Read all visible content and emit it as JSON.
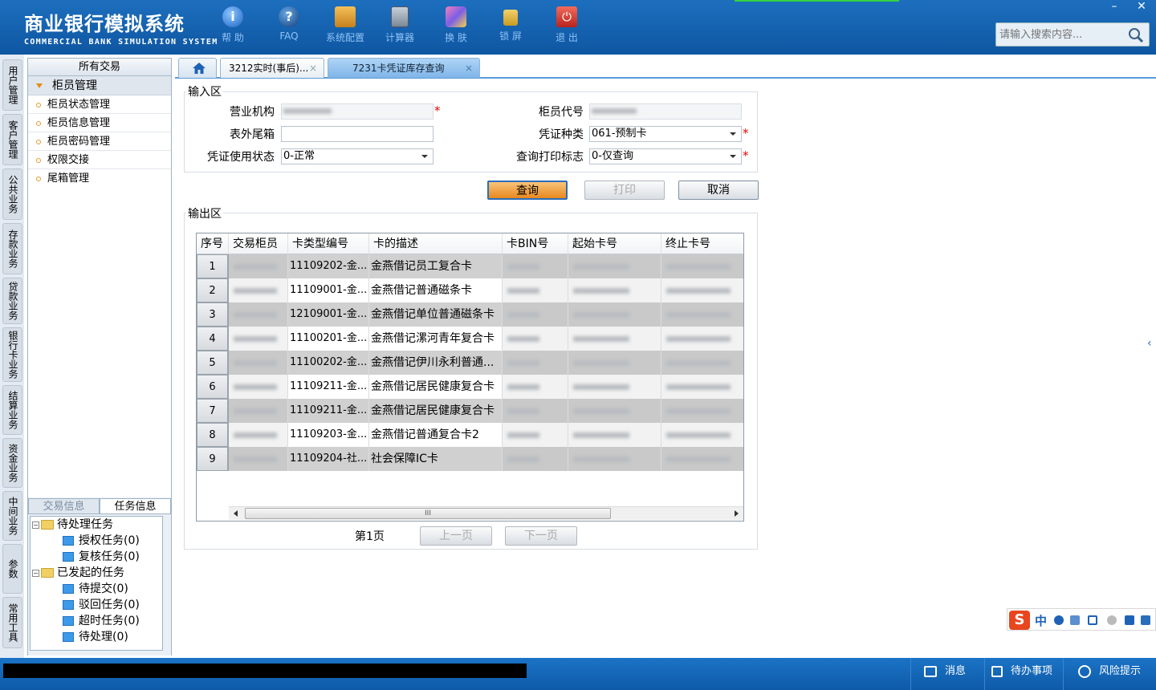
{
  "app": {
    "title_cn": "商业银行模拟系统",
    "title_en": "COMMERCIAL BANK SIMULATION SYSTEM",
    "window_buttons": [
      "–",
      "✕"
    ]
  },
  "toolbar": [
    {
      "label": "帮 助",
      "icon": "info-icon"
    },
    {
      "label": "FAQ",
      "icon": "question-icon"
    },
    {
      "label": "系统配置",
      "icon": "toolbox-icon"
    },
    {
      "label": "计算器",
      "icon": "calculator-icon"
    },
    {
      "label": "换 肤",
      "icon": "shirt-icon"
    },
    {
      "label": "锁 屏",
      "icon": "lock-icon"
    },
    {
      "label": "退 出",
      "icon": "power-icon"
    }
  ],
  "search": {
    "placeholder": "请输入搜索内容..."
  },
  "left_tabs": [
    "用户管理",
    "客户管理",
    "公共业务",
    "存款业务",
    "贷款业务",
    "银行卡业务",
    "结算业务",
    "资金业务",
    "中间业务",
    "参数",
    "常用工具"
  ],
  "sidebar": {
    "header": "所有交易",
    "group": "柜员管理",
    "items": [
      "柜员状态管理",
      "柜员信息管理",
      "柜员密码管理",
      "权限交接",
      "尾箱管理"
    ]
  },
  "task_panel": {
    "tabs": [
      "交易信息",
      "任务信息"
    ],
    "tree": [
      {
        "label": "待处理任务",
        "level": 0
      },
      {
        "label": "授权任务(0)",
        "level": 1
      },
      {
        "label": "复核任务(0)",
        "level": 1
      },
      {
        "label": "已发起的任务",
        "level": 0
      },
      {
        "label": "待提交(0)",
        "level": 1
      },
      {
        "label": "驳回任务(0)",
        "level": 1
      },
      {
        "label": "超时任务(0)",
        "level": 1
      },
      {
        "label": "待处理(0)",
        "level": 1
      }
    ]
  },
  "tabs": [
    {
      "label": "3212实时(事后)...",
      "close": "×"
    },
    {
      "label": "7231卡凭证库存查询",
      "close": "×"
    }
  ],
  "input_area": {
    "legend": "输入区",
    "fields": {
      "org_label": "营业机构",
      "teller_label": "柜员代号",
      "tail_box_label": "表外尾箱",
      "voucher_type_label": "凭证种类",
      "voucher_type_value": "061-预制卡",
      "usage_status_label": "凭证使用状态",
      "usage_status_value": "0-正常",
      "print_flag_label": "查询打印标志",
      "print_flag_value": "0-仅查询"
    },
    "required_mark": "*"
  },
  "buttons": {
    "query": "查询",
    "print": "打印",
    "cancel": "取消"
  },
  "output_area": {
    "legend": "输出区",
    "columns": [
      "序号",
      "交易柜员",
      "卡类型编号",
      "卡的描述",
      "卡BIN号",
      "起始卡号",
      "终止卡号"
    ],
    "rows": [
      {
        "no": "1",
        "type": "11109202-金...",
        "desc": "金燕借记员工复合卡"
      },
      {
        "no": "2",
        "type": "11109001-金...",
        "desc": "金燕借记普通磁条卡"
      },
      {
        "no": "3",
        "type": "12109001-金...",
        "desc": "金燕借记单位普通磁条卡"
      },
      {
        "no": "4",
        "type": "11100201-金...",
        "desc": "金燕借记漯河青年复合卡"
      },
      {
        "no": "5",
        "type": "11100202-金...",
        "desc": "金燕借记伊川永利普通..."
      },
      {
        "no": "6",
        "type": "11109211-金...",
        "desc": "金燕借记居民健康复合卡"
      },
      {
        "no": "7",
        "type": "11109211-金...",
        "desc": "金燕借记居民健康复合卡"
      },
      {
        "no": "8",
        "type": "11109203-金...",
        "desc": "金燕借记普通复合卡2"
      },
      {
        "no": "9",
        "type": "11109204-社...",
        "desc": "社会保障IC卡"
      }
    ],
    "scroll_thumb": "III"
  },
  "pagination": {
    "page": "第1页",
    "prev": "上一页",
    "next": "下一页"
  },
  "statusbar": {
    "message": "消息",
    "todo": "待办事项",
    "risk": "风险提示"
  },
  "ime": {
    "logo": "S",
    "mode": "中"
  },
  "colors": {
    "header_blue": "#1464b4",
    "accent_orange": "#e8871e",
    "tab_active": "#8fc0ef"
  }
}
